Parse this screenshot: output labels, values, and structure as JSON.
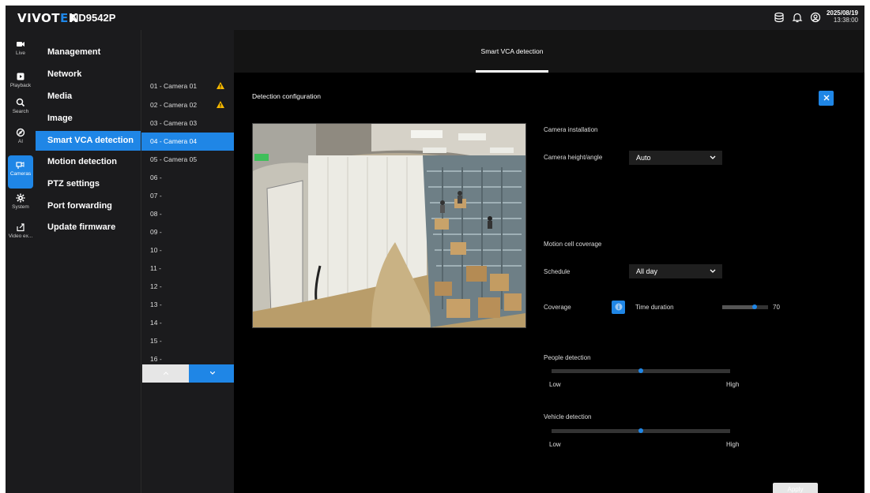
{
  "app": {
    "brand_prefix": "VIVOT",
    "brand_accent": "E",
    "brand_suffix": "K",
    "model": "ND9542P",
    "date": "2025/08/19",
    "time": "13:38:00"
  },
  "rail": {
    "items": [
      {
        "label": "Live",
        "icon": "video-camera-icon"
      },
      {
        "label": "Playback",
        "icon": "play-icon"
      },
      {
        "label": "Search",
        "icon": "search-icon"
      },
      {
        "label": "AI",
        "icon": "ai-icon"
      },
      {
        "label": "Cameras",
        "icon": "cameras-icon"
      },
      {
        "label": "System",
        "icon": "gear-icon"
      },
      {
        "label": "Video ex...",
        "icon": "export-icon"
      }
    ]
  },
  "menu": {
    "items": [
      {
        "label": "Management"
      },
      {
        "label": "Network"
      },
      {
        "label": "Media"
      },
      {
        "label": "Image"
      },
      {
        "label": "Smart VCA detection"
      },
      {
        "label": "Motion detection"
      },
      {
        "label": "PTZ settings"
      },
      {
        "label": "Port forwarding"
      },
      {
        "label": "Update firmware"
      }
    ]
  },
  "cameras": [
    {
      "label": "01 - Camera 01",
      "warning": true
    },
    {
      "label": "02 - Camera 02",
      "warning": true
    },
    {
      "label": "03 - Camera 03",
      "warning": false
    },
    {
      "label": "04 - Camera 04",
      "warning": false
    },
    {
      "label": "05 - Camera 05",
      "warning": false
    },
    {
      "label": "06 -",
      "warning": false
    },
    {
      "label": "07 -",
      "warning": false
    },
    {
      "label": "08 -",
      "warning": false
    },
    {
      "label": "09 -",
      "warning": false
    },
    {
      "label": "10 -",
      "warning": false
    },
    {
      "label": "11 -",
      "warning": false
    },
    {
      "label": "12 -",
      "warning": false
    },
    {
      "label": "13 -",
      "warning": false
    },
    {
      "label": "14 -",
      "warning": false
    },
    {
      "label": "15 -",
      "warning": false
    },
    {
      "label": "16 -",
      "warning": false
    }
  ],
  "main": {
    "tab": "Smart VCA detection",
    "panel_title": "Detection configuration",
    "camera_installation": {
      "section": "Camera installation",
      "height_angle_label": "Camera height/angle",
      "height_angle_value": "Auto"
    },
    "motion": {
      "section": "Motion cell coverage",
      "schedule_label": "Schedule",
      "schedule_value": "All day",
      "coverage_label": "Coverage",
      "time_duration_label": "Time duration",
      "time_duration_value": "70",
      "time_duration_fraction": 0.7
    },
    "people": {
      "label": "People detection",
      "low": "Low",
      "high": "High",
      "level": 0.5
    },
    "vehicle": {
      "label": "Vehicle detection",
      "low": "Low",
      "high": "High",
      "level": 0.5
    },
    "apply_label": "Apply"
  },
  "colors": {
    "accent": "#1f86e6",
    "warning": "#f5b800"
  }
}
